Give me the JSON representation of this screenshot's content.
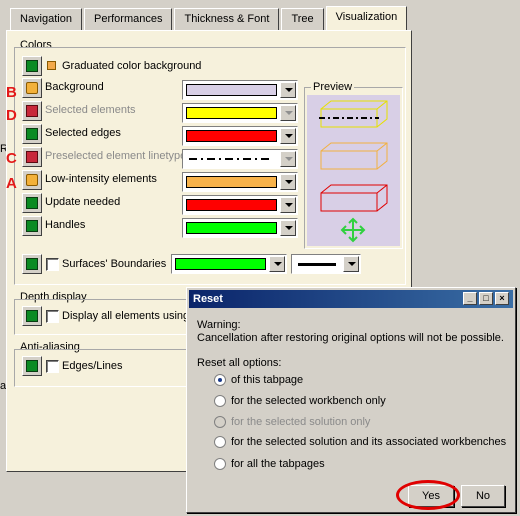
{
  "tabs": [
    {
      "label": "Navigation",
      "active": false
    },
    {
      "label": "Performances",
      "active": false
    },
    {
      "label": "Thickness & Font",
      "active": false
    },
    {
      "label": "Tree",
      "active": false
    },
    {
      "label": "Visualization",
      "active": true
    }
  ],
  "colors_group": {
    "title": "Colors",
    "graduated_label": "Graduated color background",
    "rows": [
      {
        "label": "Background",
        "color": "#d8cfe6",
        "enabled": true,
        "marker": "B"
      },
      {
        "label": "Selected elements",
        "color": "#ffff00",
        "enabled": false,
        "marker": "D"
      },
      {
        "label": "Selected edges",
        "color": "#ff0000",
        "enabled": true,
        "marker": ""
      },
      {
        "label": "Preselected element linetype",
        "color": "",
        "enabled": false,
        "marker": "C"
      },
      {
        "label": "Low-intensity elements",
        "color": "#f7b24a",
        "enabled": true,
        "marker": "A"
      },
      {
        "label": "Update needed",
        "color": "#ff0000",
        "enabled": true,
        "marker": ""
      },
      {
        "label": "Handles",
        "color": "#00ff00",
        "enabled": true,
        "marker": ""
      }
    ],
    "surfaces_label": "Surfaces' Boundaries",
    "surfaces_color": "#00ff00",
    "preview_title": "Preview",
    "preview_bg": "#d8cfe6"
  },
  "depth_group": {
    "title": "Depth display",
    "checkbox_label": "Display all elements using Z"
  },
  "aa_group": {
    "title": "Anti-aliasing",
    "checkbox_label": "Edges/Lines"
  },
  "left_fragments": {
    "a": "R",
    "b": "a"
  },
  "dialog": {
    "title": "Reset",
    "warning_title": "Warning:",
    "warning_text": "Cancellation after restoring original options will not be possible.",
    "reset_label": "Reset all options:",
    "options": [
      {
        "label": "of this tabpage",
        "checked": true,
        "enabled": true
      },
      {
        "label": "for the selected workbench only",
        "checked": false,
        "enabled": true
      },
      {
        "label": "for the selected solution only",
        "checked": false,
        "enabled": false
      },
      {
        "label": "for the selected solution and its associated workbenches",
        "checked": false,
        "enabled": true
      },
      {
        "label": "for all the tabpages",
        "checked": false,
        "enabled": true
      }
    ],
    "yes_label": "Yes",
    "no_label": "No",
    "highlight_color": "#e00000"
  }
}
